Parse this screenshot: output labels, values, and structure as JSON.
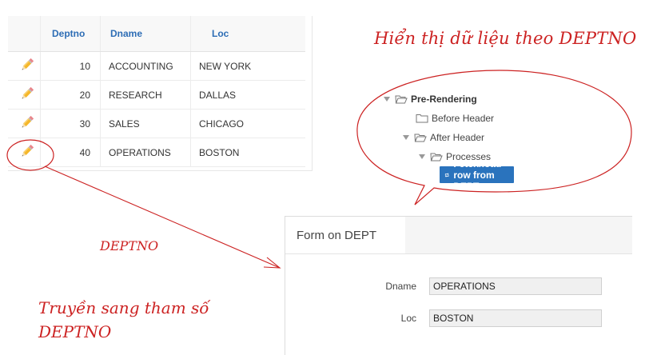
{
  "report": {
    "columns": [
      "Deptno",
      "Dname",
      "Loc"
    ],
    "rows": [
      {
        "deptno": "10",
        "dname": "ACCOUNTING",
        "loc": "NEW YORK"
      },
      {
        "deptno": "20",
        "dname": "RESEARCH",
        "loc": "DALLAS"
      },
      {
        "deptno": "30",
        "dname": "SALES",
        "loc": "CHICAGO"
      },
      {
        "deptno": "40",
        "dname": "OPERATIONS",
        "loc": "BOSTON"
      }
    ]
  },
  "annotations": {
    "display_by_deptno": "Hiển thị dữ liệu theo DEPTNO",
    "deptno": "DEPTNO",
    "pass_param": "Truyền sang tham số DEPTNO",
    "accent_color": "#cc2222"
  },
  "tree": {
    "pre_rendering": "Pre-Rendering",
    "before_header": "Before Header",
    "after_header": "After Header",
    "processes": "Processes",
    "selected_process": "Fetch/load row from DEPT",
    "selected_color": "#2a73bd"
  },
  "form": {
    "title": "Form on DEPT",
    "dname_label": "Dname",
    "dname_value": "OPERATIONS",
    "loc_label": "Loc",
    "loc_value": "BOSTON"
  }
}
